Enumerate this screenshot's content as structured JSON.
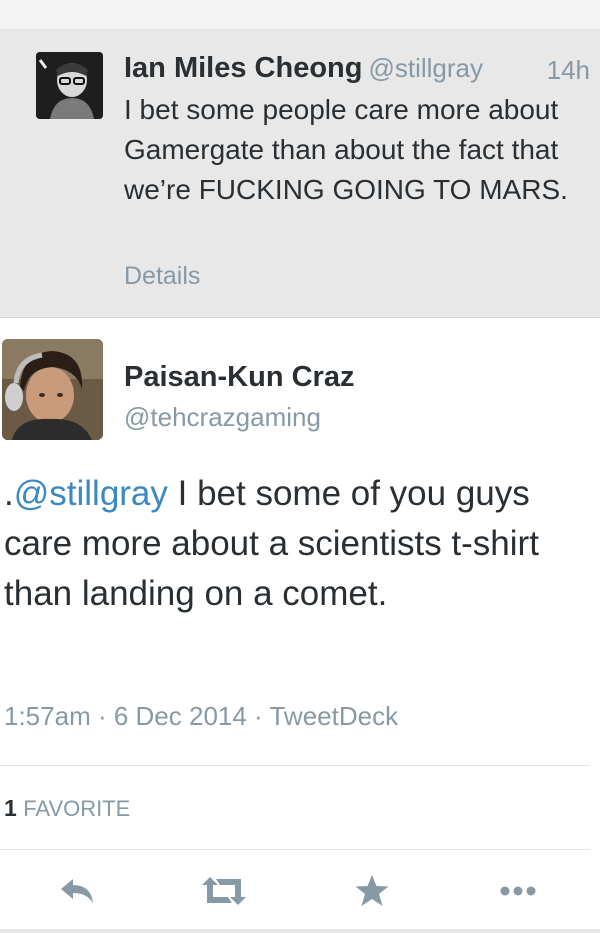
{
  "parent_tweet": {
    "name": "Ian Miles Cheong",
    "handle": "@stillgray",
    "time": "14h",
    "text": "I bet some people care more about Gamergate than about the fact that we’re FUCKING GOING TO MARS.",
    "details_label": "Details",
    "avatar_icon": "user-photo-icon"
  },
  "main_tweet": {
    "name": "Paisan-Kun Craz",
    "handle": "@tehcrazgaming",
    "text_prefix": ".",
    "mention": "@stillgray",
    "text_body": " I bet some of you guys care more about a scientists t-shirt than landing on a comet.",
    "time": "1:57am",
    "date": "6 Dec 2014",
    "source": "TweetDeck",
    "separator": " · ",
    "favorites_count": "1",
    "favorites_label": "FAVORITE",
    "avatar_icon": "user-photo-icon"
  },
  "actions": [
    {
      "name": "reply",
      "icon": "reply-icon"
    },
    {
      "name": "retweet",
      "icon": "retweet-icon"
    },
    {
      "name": "favorite",
      "icon": "star-icon"
    },
    {
      "name": "more",
      "icon": "more-icon"
    }
  ],
  "colors": {
    "mention": "#3b88c3",
    "muted": "#8899a6",
    "text": "#292f33",
    "action_icon": "#8899a6"
  }
}
